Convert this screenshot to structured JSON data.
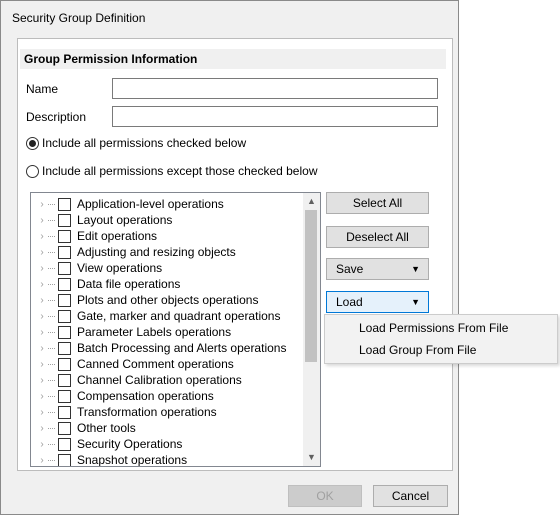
{
  "window": {
    "title": "Security Group Definition"
  },
  "group": {
    "header": "Group Permission Information",
    "name_label": "Name",
    "name_value": "",
    "description_label": "Description",
    "description_value": "",
    "radio_include": "Include all permissions checked below",
    "radio_exclude": "Include all permissions except those checked below",
    "radio_selected": "include"
  },
  "tree": {
    "items": [
      "Application-level operations",
      "Layout operations",
      "Edit operations",
      "Adjusting and resizing objects",
      "View operations",
      "Data file operations",
      "Plots and other objects operations",
      "Gate, marker and quadrant operations",
      "Parameter Labels operations",
      "Batch Processing and Alerts operations",
      "Canned Comment operations",
      "Channel Calibration operations",
      "Compensation operations",
      "Transformation operations",
      "Other tools",
      "Security Operations",
      "Snapshot operations"
    ]
  },
  "buttons": {
    "select_all": "Select All",
    "deselect_all": "Deselect All",
    "save": "Save",
    "load": "Load",
    "ok": "OK",
    "cancel": "Cancel"
  },
  "load_menu": {
    "items": [
      "Load Permissions From File",
      "Load Group From File"
    ]
  },
  "icons": {
    "expand": "chevron-right-icon",
    "dropdown": "chevron-down-icon",
    "scroll_up": "arrow-up-icon",
    "scroll_down": "arrow-down-icon"
  }
}
